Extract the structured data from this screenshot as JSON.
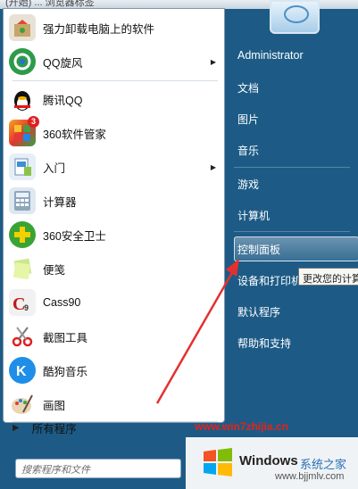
{
  "top_strip_text": "(开始) ... 浏览器标签",
  "left_items": [
    {
      "label": "强力卸载电脑上的软件",
      "arrow": false
    },
    {
      "label": "QQ旋风",
      "arrow": true
    },
    {
      "label": "腾讯QQ",
      "arrow": false
    },
    {
      "label": "360软件管家",
      "arrow": false
    },
    {
      "label": "入门",
      "arrow": true
    },
    {
      "label": "计算器",
      "arrow": false
    },
    {
      "label": "360安全卫士",
      "arrow": false
    },
    {
      "label": "便笺",
      "arrow": false
    },
    {
      "label": "Cass90",
      "arrow": false
    },
    {
      "label": "截图工具",
      "arrow": false
    },
    {
      "label": "酷狗音乐",
      "arrow": false
    },
    {
      "label": "画图",
      "arrow": false
    }
  ],
  "badge_360": "3",
  "all_programs": "所有程序",
  "search_placeholder": "搜索程序和文件",
  "right_items": [
    "Administrator",
    "文档",
    "图片",
    "音乐",
    "游戏",
    "计算机",
    "控制面板",
    "设备和打印机",
    "默认程序",
    "帮助和支持"
  ],
  "tooltip": "更改您的计算机设置",
  "watermark_url": "www.win7zhijia.cn",
  "brand": {
    "windows": "Windows",
    "cn": "系统之家",
    "url": "www.bjjmlv.com"
  },
  "colors": {
    "arrow": "#e53030",
    "accent": "#1d5b86"
  }
}
